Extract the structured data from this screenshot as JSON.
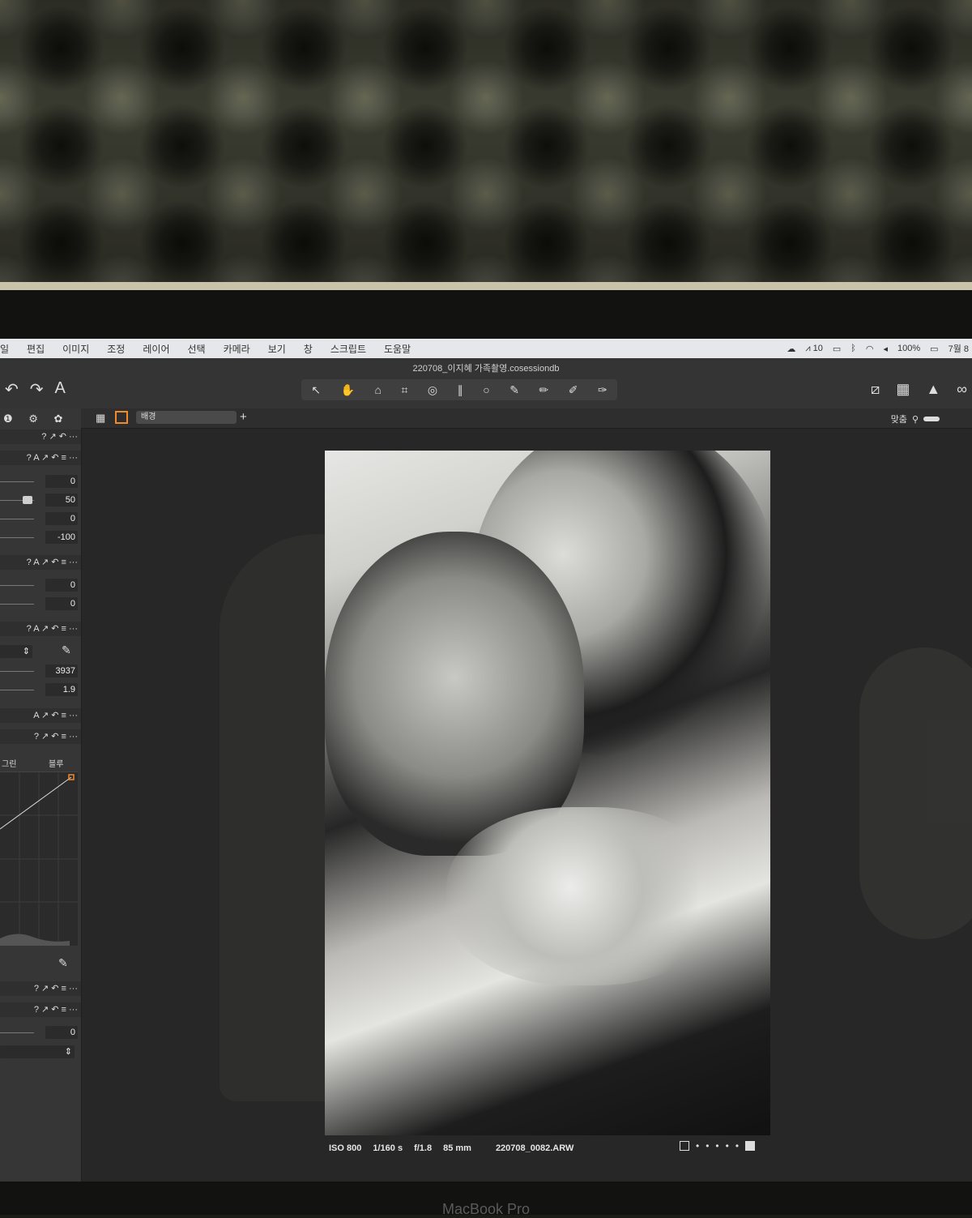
{
  "menubar": {
    "items": [
      "일",
      "편집",
      "이미지",
      "조정",
      "레이어",
      "선택",
      "카메라",
      "보기",
      "창",
      "스크립트",
      "도움말"
    ],
    "status": {
      "cloud_icon": "cloud-icon",
      "adobe_count": "10",
      "battery": "100%",
      "date": "7월 8"
    }
  },
  "window": {
    "title": "220708_이지혜 가족촬영.cosessiondb"
  },
  "toolbar": {
    "left_icons": [
      "undo-icon",
      "redo-icon",
      "text-icon"
    ],
    "left_glyphs": [
      "↶",
      "↷",
      "A"
    ],
    "tools": [
      "↖",
      "✋",
      "⌂",
      "⌗",
      "◎",
      "∥",
      "○",
      "✎",
      "✏",
      "✐",
      "✑"
    ],
    "right_glyphs": [
      "⧄",
      "▦",
      "▲",
      "∞"
    ]
  },
  "viewer_bar": {
    "dropdown": "배경",
    "plus": "+",
    "fit_label": "맞춤"
  },
  "panel": {
    "tab_glyphs": "❶ ⚙ ✿",
    "headers": [
      "? ↗ ↶ ···",
      "? A ↗ ↶ ≡ ···",
      "? A ↗ ↶ ≡ ···",
      "? A ↗ ↶ ≡ ···",
      "A ↗ ↶ ≡ ···",
      "? ↗ ↶ ≡ ···",
      "? ↗ ↶ ≡ ···",
      "? ↗ ↶ ≡ ···"
    ],
    "values_group1": [
      "0",
      "50",
      "0",
      "-100"
    ],
    "values_group2": [
      "0",
      "0"
    ],
    "values_group3": [
      "3937",
      "1.9"
    ],
    "curve_labels": [
      "그린",
      "블루"
    ],
    "value_bottom": "0"
  },
  "image_info": {
    "iso": "ISO 800",
    "shutter": "1/160 s",
    "aperture": "f/1.8",
    "focal": "85 mm",
    "filename": "220708_0082.ARW"
  },
  "device": {
    "brand": "MacBook Pro"
  },
  "colors": {
    "accent": "#f08a2c",
    "panel_bg": "#363636",
    "canvas_bg": "#272727"
  }
}
